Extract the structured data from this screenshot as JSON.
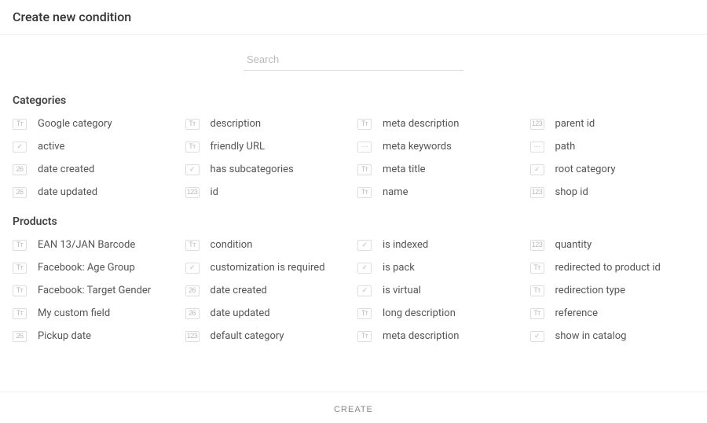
{
  "header": {
    "title": "Create new condition"
  },
  "search": {
    "placeholder": "Search"
  },
  "footer": {
    "create_label": "CREATE"
  },
  "icon_glyphs": {
    "text": "Tᴛ",
    "bool": "✓",
    "date": "26",
    "number": "123",
    "list": "⋯"
  },
  "sections": [
    {
      "title": "Categories",
      "columns": [
        [
          {
            "icon": "text",
            "label": "Google category"
          },
          {
            "icon": "bool",
            "label": "active"
          },
          {
            "icon": "date",
            "label": "date created"
          },
          {
            "icon": "date",
            "label": "date updated"
          }
        ],
        [
          {
            "icon": "text",
            "label": "description"
          },
          {
            "icon": "text",
            "label": "friendly URL"
          },
          {
            "icon": "bool",
            "label": "has subcategories"
          },
          {
            "icon": "number",
            "label": "id"
          }
        ],
        [
          {
            "icon": "text",
            "label": "meta description"
          },
          {
            "icon": "list",
            "label": "meta keywords"
          },
          {
            "icon": "text",
            "label": "meta title"
          },
          {
            "icon": "text",
            "label": "name"
          }
        ],
        [
          {
            "icon": "number",
            "label": "parent id"
          },
          {
            "icon": "list",
            "label": "path"
          },
          {
            "icon": "bool",
            "label": "root category"
          },
          {
            "icon": "number",
            "label": "shop id"
          }
        ]
      ]
    },
    {
      "title": "Products",
      "columns": [
        [
          {
            "icon": "text",
            "label": "EAN 13/JAN Barcode"
          },
          {
            "icon": "text",
            "label": "Facebook: Age Group"
          },
          {
            "icon": "text",
            "label": "Facebook: Target Gender"
          },
          {
            "icon": "text",
            "label": "My custom field"
          },
          {
            "icon": "date",
            "label": "Pickup date"
          }
        ],
        [
          {
            "icon": "text",
            "label": "condition"
          },
          {
            "icon": "bool",
            "label": "customization is required"
          },
          {
            "icon": "date",
            "label": "date created"
          },
          {
            "icon": "date",
            "label": "date updated"
          },
          {
            "icon": "number",
            "label": "default category"
          }
        ],
        [
          {
            "icon": "bool",
            "label": "is indexed"
          },
          {
            "icon": "bool",
            "label": "is pack"
          },
          {
            "icon": "bool",
            "label": "is virtual"
          },
          {
            "icon": "text",
            "label": "long description"
          },
          {
            "icon": "text",
            "label": "meta description"
          }
        ],
        [
          {
            "icon": "number",
            "label": "quantity"
          },
          {
            "icon": "text",
            "label": "redirected to product id"
          },
          {
            "icon": "text",
            "label": "redirection type"
          },
          {
            "icon": "text",
            "label": "reference"
          },
          {
            "icon": "bool",
            "label": "show in catalog"
          }
        ]
      ]
    }
  ]
}
